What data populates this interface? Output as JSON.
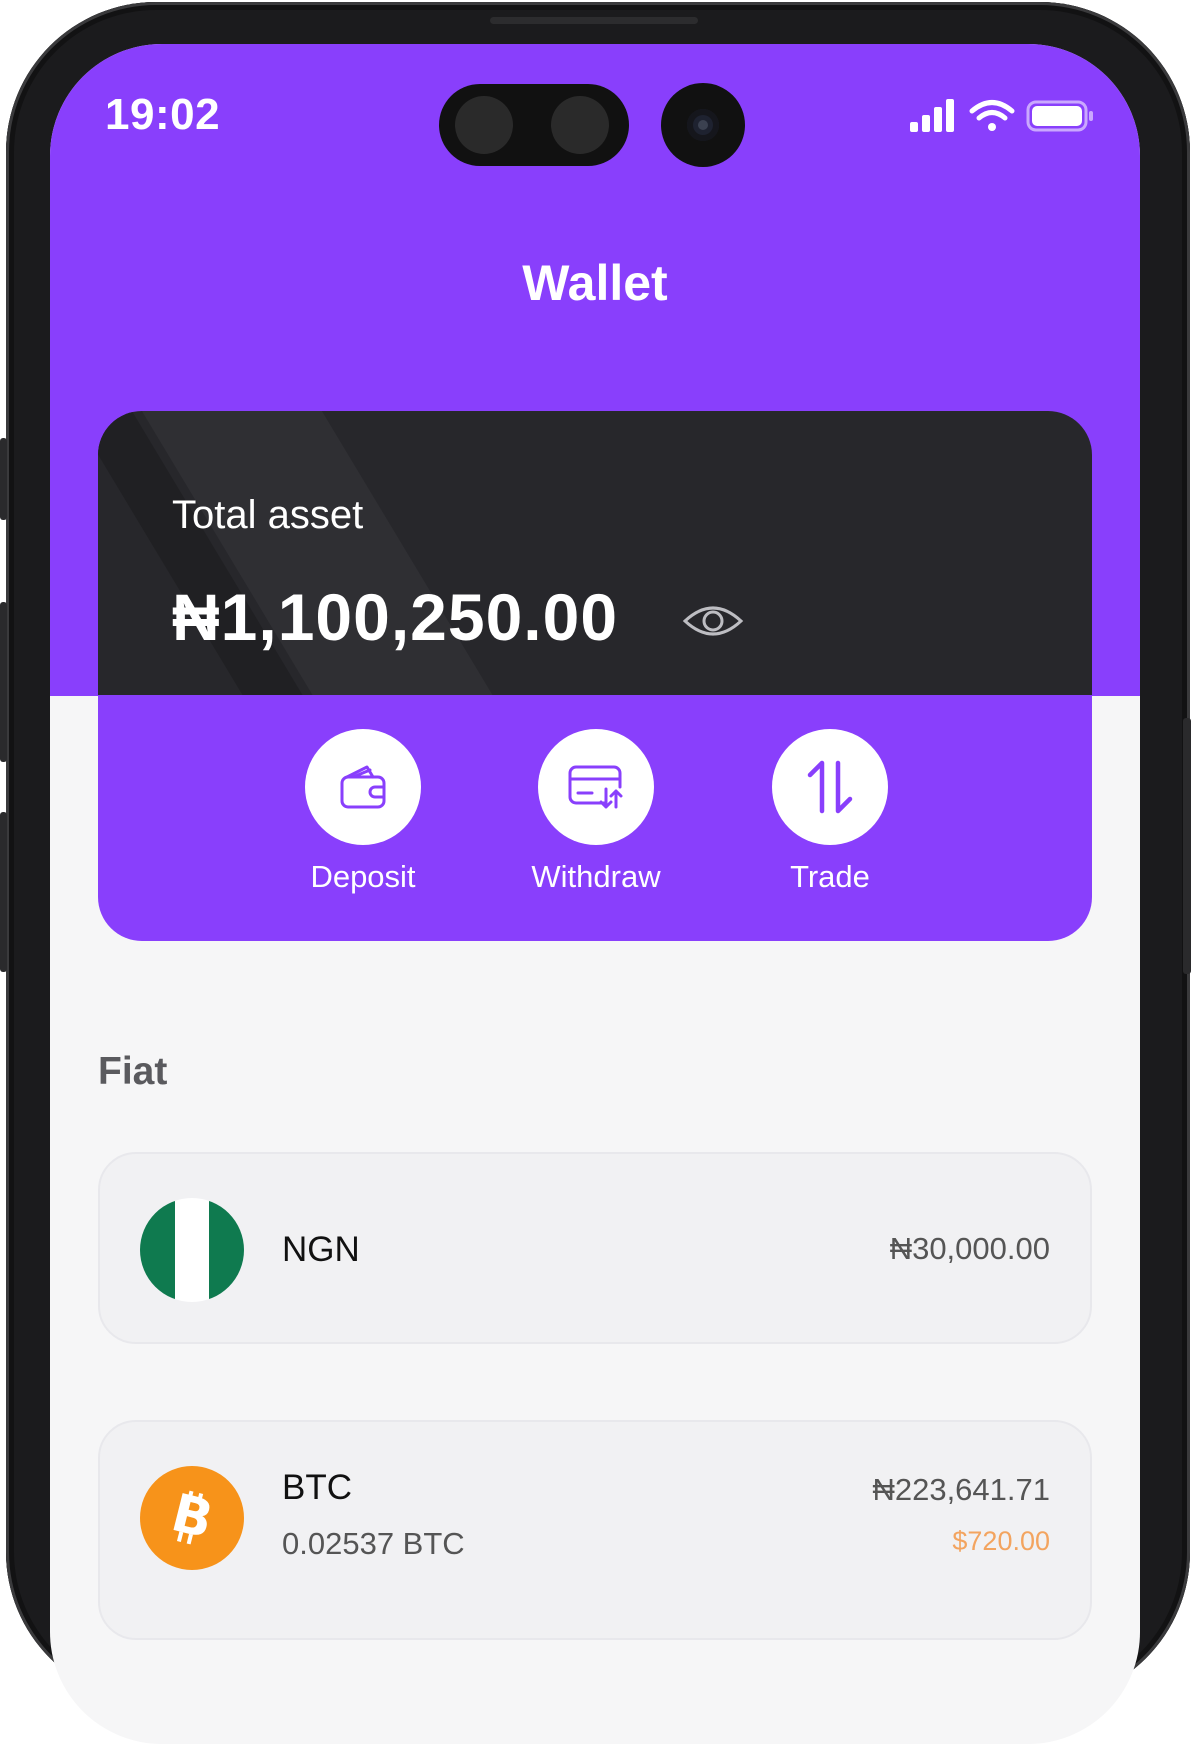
{
  "status_bar": {
    "time": "19:02"
  },
  "header": {
    "title": "Wallet"
  },
  "balance": {
    "label": "Total asset",
    "value": "₦1,100,250.00"
  },
  "actions": [
    {
      "label": "Deposit",
      "icon": "wallet-icon"
    },
    {
      "label": "Withdraw",
      "icon": "card-transfer-icon"
    },
    {
      "label": "Trade",
      "icon": "swap-arrows-icon"
    }
  ],
  "sections": {
    "fiat": {
      "title": "Fiat",
      "items": [
        {
          "code": "NGN",
          "value": "₦30,000.00",
          "icon": "nigeria-flag-icon"
        }
      ]
    },
    "crypto": {
      "items": [
        {
          "code": "BTC",
          "amount": "0.02537 BTC",
          "value": "₦223,641.71",
          "usd_value": "$720.00",
          "icon": "bitcoin-icon"
        }
      ]
    }
  },
  "colors": {
    "brand_purple": "#893ffc",
    "card_dark": "#27272b",
    "ngn_green": "#0f7a4f",
    "btc_orange": "#f7931a",
    "usd_text": "#f3a45f"
  }
}
